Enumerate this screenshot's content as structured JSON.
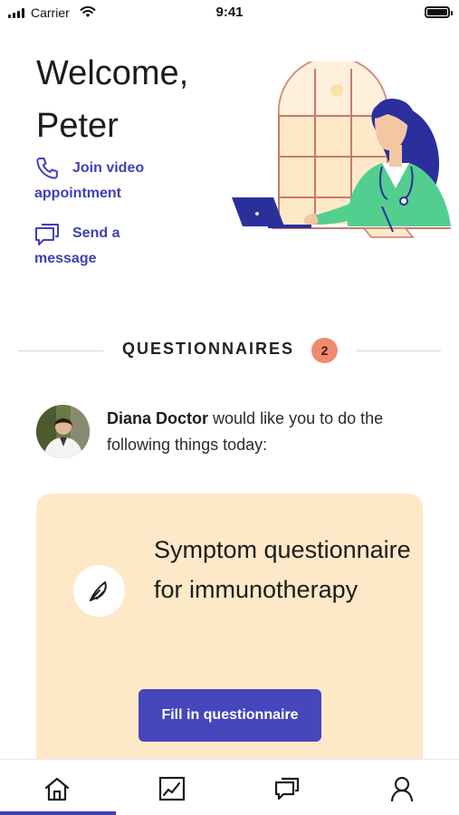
{
  "status_bar": {
    "carrier": "Carrier",
    "time": "9:41"
  },
  "greeting": {
    "line1": "Welcome,",
    "line2": "Peter"
  },
  "actions": {
    "video": {
      "line1": "Join video",
      "line2": "appointment",
      "icon": "phone-icon"
    },
    "message": {
      "line1": "Send a",
      "line2": "message",
      "icon": "chat-icon"
    }
  },
  "questionnaires": {
    "title": "QUESTIONNAIRES",
    "count": "2"
  },
  "doctor": {
    "name": "Diana Doctor",
    "message": " would like you to do the following things today:"
  },
  "card": {
    "icon": "pen-icon",
    "title": "Symptom questionnaire for immunotherapy",
    "button_label": "Fill in questionnaire"
  },
  "tabs": [
    {
      "id": "home",
      "icon": "home-icon",
      "active": true
    },
    {
      "id": "stats",
      "icon": "chart-icon",
      "active": false
    },
    {
      "id": "messages",
      "icon": "chat-icon",
      "active": false
    },
    {
      "id": "profile",
      "icon": "person-icon",
      "active": false
    }
  ],
  "colors": {
    "accent": "#4646bd",
    "link": "#4040b8",
    "badge": "#ef8a6f",
    "card_background": "#fde9c8",
    "illustration_green": "#52cf8e",
    "illustration_navy": "#2a2f9c"
  }
}
